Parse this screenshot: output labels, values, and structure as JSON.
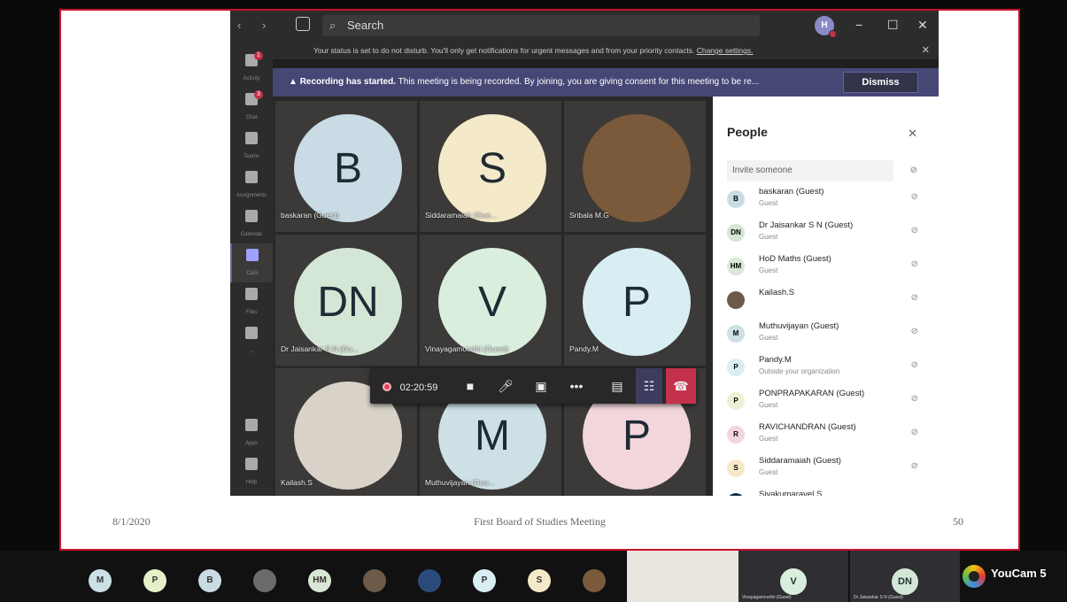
{
  "slide": {
    "date": "8/1/2020",
    "title": "First Board of Studies Meeting",
    "page_number": "50"
  },
  "titlebar": {
    "search_placeholder": "Search",
    "user_initial": "H",
    "minimize": "−",
    "maximize": "☐",
    "close": "✕"
  },
  "rail": [
    {
      "label": "Activity",
      "badge": "1"
    },
    {
      "label": "Chat",
      "badge": "3"
    },
    {
      "label": "Teams"
    },
    {
      "label": "Assignments"
    },
    {
      "label": "Calendar"
    },
    {
      "label": "Calls",
      "active": true
    },
    {
      "label": "Files"
    },
    {
      "label": "..."
    },
    {
      "label": "Apps"
    },
    {
      "label": "Help"
    }
  ],
  "status_bar": {
    "text": "Your status is set to do not disturb. You'll only get notifications for urgent messages and from your priority contacts.",
    "link": "Change settings."
  },
  "recording_bar": {
    "bold": "Recording has started.",
    "text": "This meeting is being recorded. By joining, you are giving consent for this meeting to be re...",
    "dismiss": "Dismiss"
  },
  "tiles": [
    {
      "initials": "B",
      "name": "baskaran (Guest)",
      "color": "#c9dbe4"
    },
    {
      "initials": "S",
      "name": "Siddaramaiah (Gue...",
      "color": "#f4e9c9"
    },
    {
      "initials": "",
      "name": "Sribala M.G",
      "color": "#7a5a3a"
    },
    {
      "initials": "DN",
      "name": "Dr Jaisankar S N (Gu...",
      "color": "#d4e6d6"
    },
    {
      "initials": "V",
      "name": "Vinayagamoorthi (Guest)",
      "color": "#d9eedd"
    },
    {
      "initials": "P",
      "name": "Pandy.M",
      "color": "#d8eef3"
    },
    {
      "initials": "",
      "name": "Kailash.S",
      "color": "#d8d2c8"
    },
    {
      "initials": "M",
      "name": "Muthuvijayan (Gue...",
      "color": "#cde0e6"
    },
    {
      "initials": "P",
      "name": "",
      "color": "#f3d6dc"
    }
  ],
  "call_controls": {
    "duration": "02:20:59"
  },
  "people": {
    "title": "People",
    "invite_placeholder": "Invite someone",
    "list": [
      {
        "initials": "B",
        "name": "baskaran (Guest)",
        "sub": "Guest",
        "color": "#c9dbe4"
      },
      {
        "initials": "DN",
        "name": "Dr Jaisankar S N (Guest)",
        "sub": "Guest",
        "color": "#d4e6d6"
      },
      {
        "initials": "HM",
        "name": "HoD Maths (Guest)",
        "sub": "Guest",
        "color": "#d9e8d6"
      },
      {
        "initials": "",
        "name": "Kailash.S",
        "sub": "",
        "color": "#6e5a48"
      },
      {
        "initials": "M",
        "name": "Muthuvijayan (Guest)",
        "sub": "Guest",
        "color": "#cde0e6"
      },
      {
        "initials": "P",
        "name": "Pandy.M",
        "sub": "Outside your organization",
        "color": "#d8eef3"
      },
      {
        "initials": "P",
        "name": "PONPRAPAKARAN (Guest)",
        "sub": "Guest",
        "color": "#eef0d4"
      },
      {
        "initials": "R",
        "name": "RAVICHANDRAN (Guest)",
        "sub": "Guest",
        "color": "#f3d6dc"
      },
      {
        "initials": "S",
        "name": "Siddaramaiah (Guest)",
        "sub": "Guest",
        "color": "#f4e9c9"
      },
      {
        "initials": "",
        "name": "Sivakumaravel.S",
        "sub": "",
        "color": "#0e2c4e"
      }
    ]
  },
  "bottom_strip": {
    "chips": [
      {
        "initials": "M",
        "color": "#cde0e6"
      },
      {
        "initials": "P",
        "color": "#e6f0c8"
      },
      {
        "initials": "B",
        "color": "#c9dbe4"
      },
      {
        "initials": "",
        "color": "#6b6b6b"
      },
      {
        "initials": "HM",
        "color": "#d9e8d6"
      },
      {
        "initials": "",
        "color": "#6e5a48"
      },
      {
        "initials": "",
        "color": "#2a4a7a"
      },
      {
        "initials": "P",
        "color": "#d8eef3"
      },
      {
        "initials": "S",
        "color": "#f4e9c9"
      },
      {
        "initials": "",
        "color": "#7a5a3a"
      }
    ],
    "video_tiles": [
      {
        "initials": "V",
        "name": "Vinayagamoorthi (Guest)",
        "color": "#d9eedd"
      },
      {
        "initials": "DN",
        "name": "Dr Jaisankar S N (Guest)",
        "color": "#d4e6d6"
      }
    ],
    "youcam": {
      "title": "YouCam 5"
    }
  }
}
